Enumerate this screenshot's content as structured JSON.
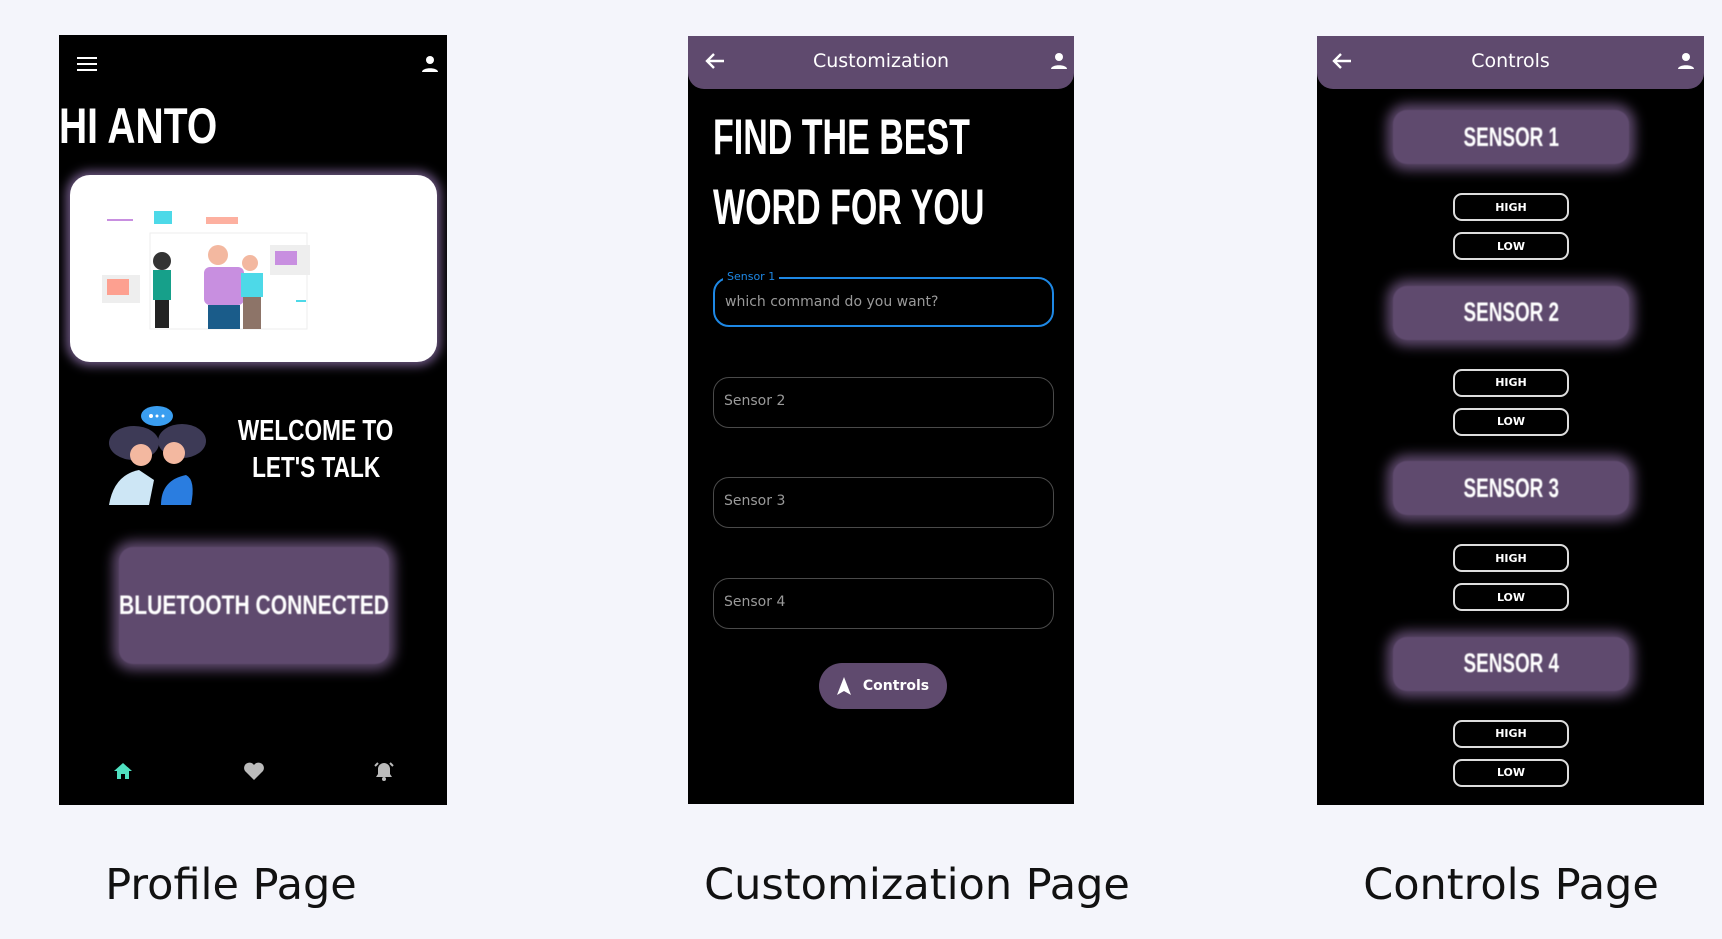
{
  "profile": {
    "greeting": "HI ANTO",
    "welcome_line1": "WELCOME TO",
    "welcome_line2": "LET'S TALK",
    "bluetooth_status": "BLUETOOTH CONNECTED",
    "nav": [
      {
        "icon": "home-icon",
        "active": true
      },
      {
        "icon": "heart-icon",
        "active": false
      },
      {
        "icon": "bell-icon",
        "active": false
      }
    ],
    "caption": "Profile Page"
  },
  "customization": {
    "title": "Customization",
    "headline_line1": "FIND THE BEST",
    "headline_line2": "WORD FOR YOU",
    "fields": [
      {
        "label": "Sensor 1",
        "placeholder": "which command do you want?"
      },
      {
        "placeholder": "Sensor 2"
      },
      {
        "placeholder": "Sensor 3"
      },
      {
        "placeholder": "Sensor 4"
      }
    ],
    "controls_button": "Controls",
    "caption": "Customization Page"
  },
  "controls": {
    "title": "Controls",
    "sensors": [
      {
        "name": "SENSOR 1",
        "high": "HIGH",
        "low": "LOW"
      },
      {
        "name": "SENSOR 2",
        "high": "HIGH",
        "low": "LOW"
      },
      {
        "name": "SENSOR 3",
        "high": "HIGH",
        "low": "LOW"
      },
      {
        "name": "SENSOR 4",
        "high": "HIGH",
        "low": "LOW"
      }
    ],
    "caption": "Controls Page"
  },
  "colors": {
    "accent": "#5f4a6e",
    "focus": "#1e88e5",
    "active_nav": "#4fe0c0"
  }
}
